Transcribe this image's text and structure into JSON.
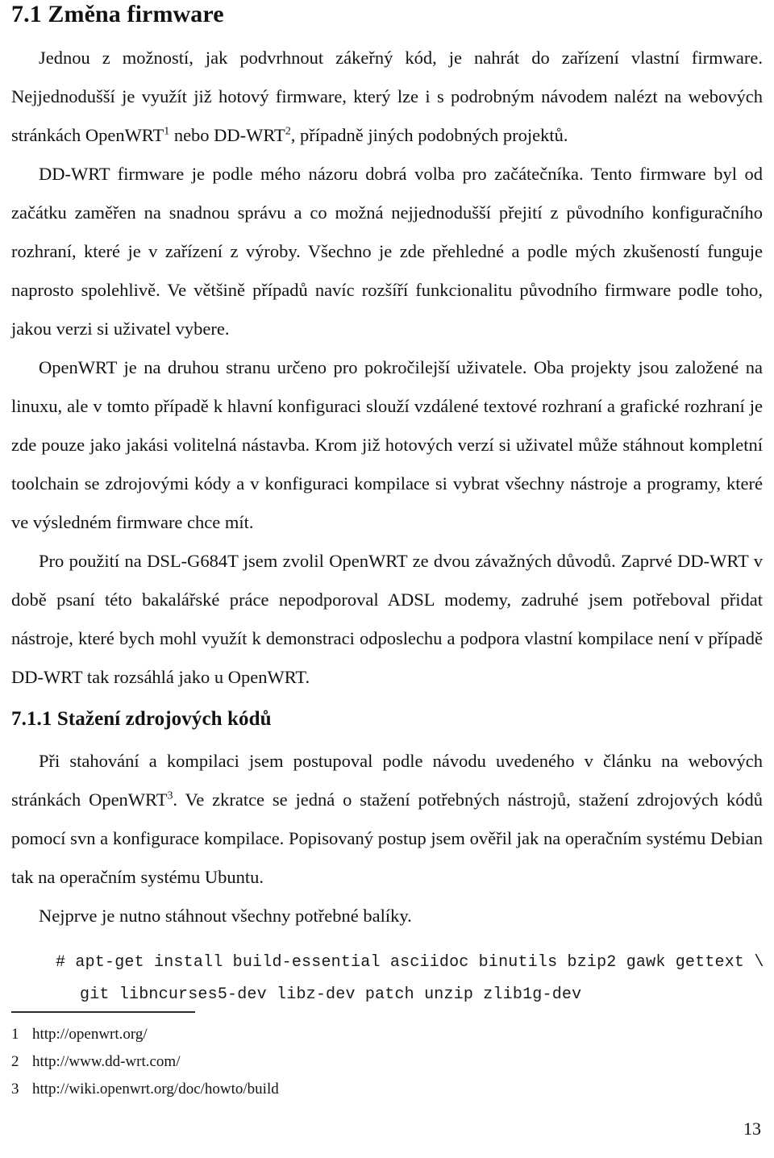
{
  "document": {
    "language": "cs",
    "page_number": "13"
  },
  "sections": {
    "heading_main": "7.1 Změna firmware",
    "heading_sub": "7.1.1 Stažení zdrojových kódů"
  },
  "paragraphs": {
    "p1_a": "Jednou z možností, jak podvrhnout zákeřný kód, je nahrát do zařízení vlastní firmware. Nejjednodušší je využít již hotový firmware, který lze i s podrobným návodem nalézt na webových stránkách OpenWRT",
    "p1_sup1": "1",
    "p1_b": " nebo DD-WRT",
    "p1_sup2": "2",
    "p1_c": ", případně jiných podobných projektů.",
    "p2": "DD-WRT firmware je podle mého názoru dobrá volba pro začátečníka. Tento firmware byl od začátku zaměřen na snadnou správu a co možná nejjednodušší přejití z původního konfiguračního rozhraní, které je v zařízení z výroby. Všechno je zde přehledné a podle mých zkušeností funguje naprosto spolehlivě. Ve většině případů navíc rozšíří funkcionalitu původního firmware podle toho, jakou verzi si uživatel vybere.",
    "p3": "OpenWRT je na druhou stranu určeno pro pokročilejší uživatele. Oba projekty jsou založené na linuxu, ale v tomto případě k hlavní konfiguraci slouží vzdálené textové rozhraní a grafické rozhraní je zde pouze jako jakási volitelná nástavba. Krom již hotových verzí si uživatel může stáhnout kompletní toolchain se zdrojovými kódy a v konfiguraci kompilace si vybrat všechny nástroje a programy, které ve výsledném firmware chce mít.",
    "p4": "Pro použití na DSL-G684T jsem zvolil OpenWRT ze dvou závažných důvodů. Zaprvé DD-WRT v době psaní této bakalářské práce nepodporoval ADSL modemy, zadruhé jsem potřeboval přidat nástroje, které bych mohl využít k demonstraci odposlechu a podpora vlastní kompilace není v případě DD-WRT tak rozsáhlá jako u OpenWRT.",
    "p5_a": "Při stahování a kompilaci jsem postupoval podle návodu uvedeného v článku na webových stránkách OpenWRT",
    "p5_sup3": "3",
    "p5_b": ". Ve zkratce se jedná o stažení potřebných nástrojů, stažení zdrojových kódů pomocí svn a konfigurace kompilace. Popisovaný postup jsem ověřil jak na operačním systému Debian tak na operačním systému Ubuntu.",
    "p6": "Nejprve je nutno stáhnout všechny potřebné balíky."
  },
  "code_block": {
    "line1": "# apt-get install build-essential asciidoc binutils bzip2 gawk gettext \\",
    "line2": "git libncurses5-dev libz-dev patch unzip zlib1g-dev"
  },
  "footnotes": [
    {
      "number": "1",
      "text": "http://openwrt.org/"
    },
    {
      "number": "2",
      "text": "http://www.dd-wrt.com/"
    },
    {
      "number": "3",
      "text": "http://wiki.openwrt.org/doc/howto/build"
    }
  ]
}
